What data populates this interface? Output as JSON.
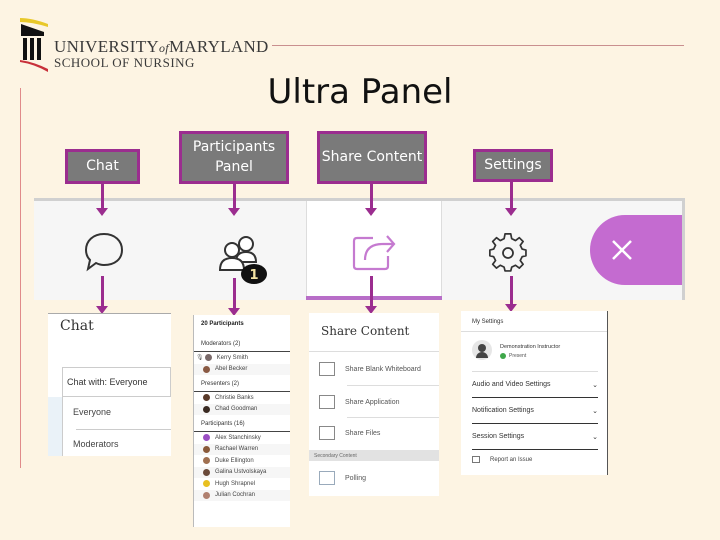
{
  "logo": {
    "line1_a": "UNIVERSITY",
    "line1_of": "of",
    "line1_b": "MARYLAND",
    "line2": "SCHOOL OF NURSING"
  },
  "title": "Ultra Panel",
  "labels": {
    "chat": "Chat",
    "participants": "Participants Panel",
    "share": "Share Content",
    "settings": "Settings"
  },
  "toolbar": {
    "icons": [
      "chat-bubble-icon",
      "participants-icon",
      "share-content-icon",
      "gear-icon",
      "close-icon"
    ],
    "participants_badge": "1",
    "active_tab": "share-content",
    "accent_color": "#c46bd0"
  },
  "chat_panel": {
    "title": "Chat",
    "select_value": "Chat with: Everyone",
    "options": [
      "Everyone",
      "Moderators"
    ]
  },
  "participants_panel": {
    "header": "20 Participants",
    "sections": [
      {
        "label": "Moderators (2)",
        "people": [
          {
            "name": "Kerry Smith",
            "avatar_color": "#7a6a6a",
            "mic": true
          },
          {
            "name": "Abel Becker",
            "avatar_color": "#8a5a44"
          }
        ]
      },
      {
        "label": "Presenters (2)",
        "people": [
          {
            "name": "Christie Banks",
            "avatar_color": "#5a3a2a"
          },
          {
            "name": "Chad Goodman",
            "avatar_color": "#3a2a22"
          }
        ]
      },
      {
        "label": "Participants (16)",
        "people": [
          {
            "name": "Alex Stanchinsky",
            "avatar_color": "#9b4fc4"
          },
          {
            "name": "Rachael Warren",
            "avatar_color": "#8a5a3a"
          },
          {
            "name": "Duke Ellington",
            "avatar_color": "#a07050"
          },
          {
            "name": "Galina Ustvolskaya",
            "avatar_color": "#6a4a3a"
          },
          {
            "name": "Hugh Shrapnel",
            "avatar_color": "#e8c020"
          },
          {
            "name": "Julian Cochran",
            "avatar_color": "#b08070"
          }
        ]
      }
    ]
  },
  "share_panel": {
    "title": "Share Content",
    "items": [
      "Share Blank Whiteboard",
      "Share Application",
      "Share Files"
    ],
    "secondary_label": "Secondary Content",
    "secondary_items": [
      "Polling"
    ]
  },
  "settings_panel": {
    "title": "My Settings",
    "user_name": "Demonstration Instructor",
    "user_status": "Present",
    "sections": [
      "Audio and Video Settings",
      "Notification Settings",
      "Session Settings"
    ],
    "report": "Report an Issue"
  }
}
